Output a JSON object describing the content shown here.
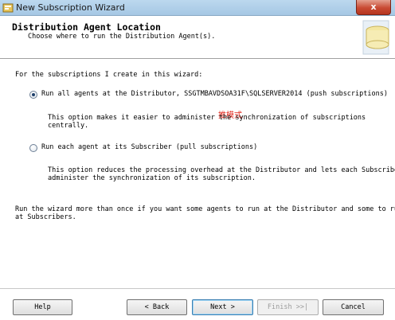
{
  "window": {
    "title": "New Subscription Wizard",
    "close_glyph": "x"
  },
  "header": {
    "title": "Distribution Agent Location",
    "subtitle": "Choose where to run the Distribution Agent(s)."
  },
  "content": {
    "intro": "For the subscriptions I create in this wizard:",
    "options": [
      {
        "label": "Run all agents at the Distributor, SSGTMBAVDSOA31F\\SQLSERVER2014 (push subscriptions)",
        "selected": true,
        "description_line1": "This option makes it easier to administer the synchronization of subscriptions",
        "description_line2": "centrally."
      },
      {
        "label": "Run each agent at its Subscriber (pull subscriptions)",
        "selected": false,
        "description_line1": "This option reduces the processing overhead at the Distributor and lets each Subscriber",
        "description_line2": "administer the synchronization of its subscription."
      }
    ],
    "annotation": "推模式",
    "note_line1": "Run the wizard more than once if you want some agents to run at the Distributor and some to run",
    "note_line2": "at Subscribers."
  },
  "buttons": {
    "help": "Help",
    "back": "< Back",
    "next": "Next >",
    "finish": "Finish >>|",
    "cancel": "Cancel"
  },
  "colors": {
    "annotation": "#e0261b",
    "titlebar": "#bcd8ee",
    "close": "#c94a33"
  }
}
